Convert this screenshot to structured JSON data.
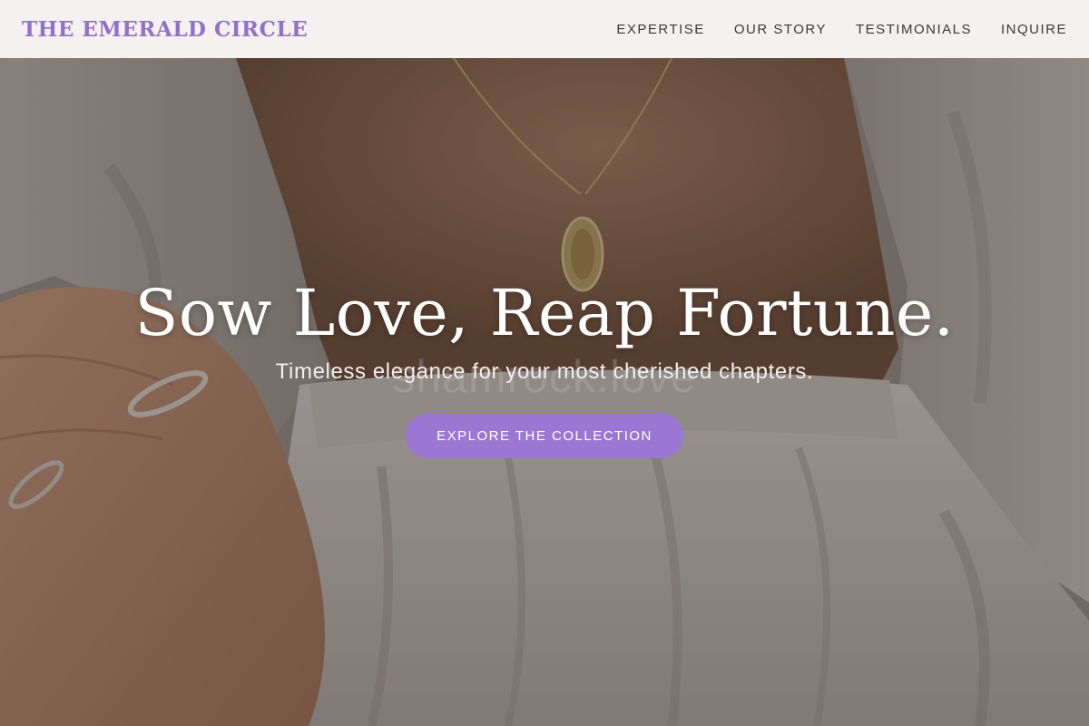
{
  "header": {
    "logo": "THE EMERALD CIRCLE",
    "nav": [
      {
        "label": "EXPERTISE"
      },
      {
        "label": "OUR STORY"
      },
      {
        "label": "TESTIMONIALS"
      },
      {
        "label": "INQUIRE"
      }
    ]
  },
  "hero": {
    "title": "Sow Love, Reap Fortune.",
    "subtitle": "Timeless elegance for your most cherished chapters.",
    "watermark": "shamrock.love",
    "cta_label": "EXPLORE THE COLLECTION"
  },
  "colors": {
    "brand_purple": "#9370c9",
    "cta_purple": "#9b77d3",
    "header_bg": "#faf9f8"
  }
}
